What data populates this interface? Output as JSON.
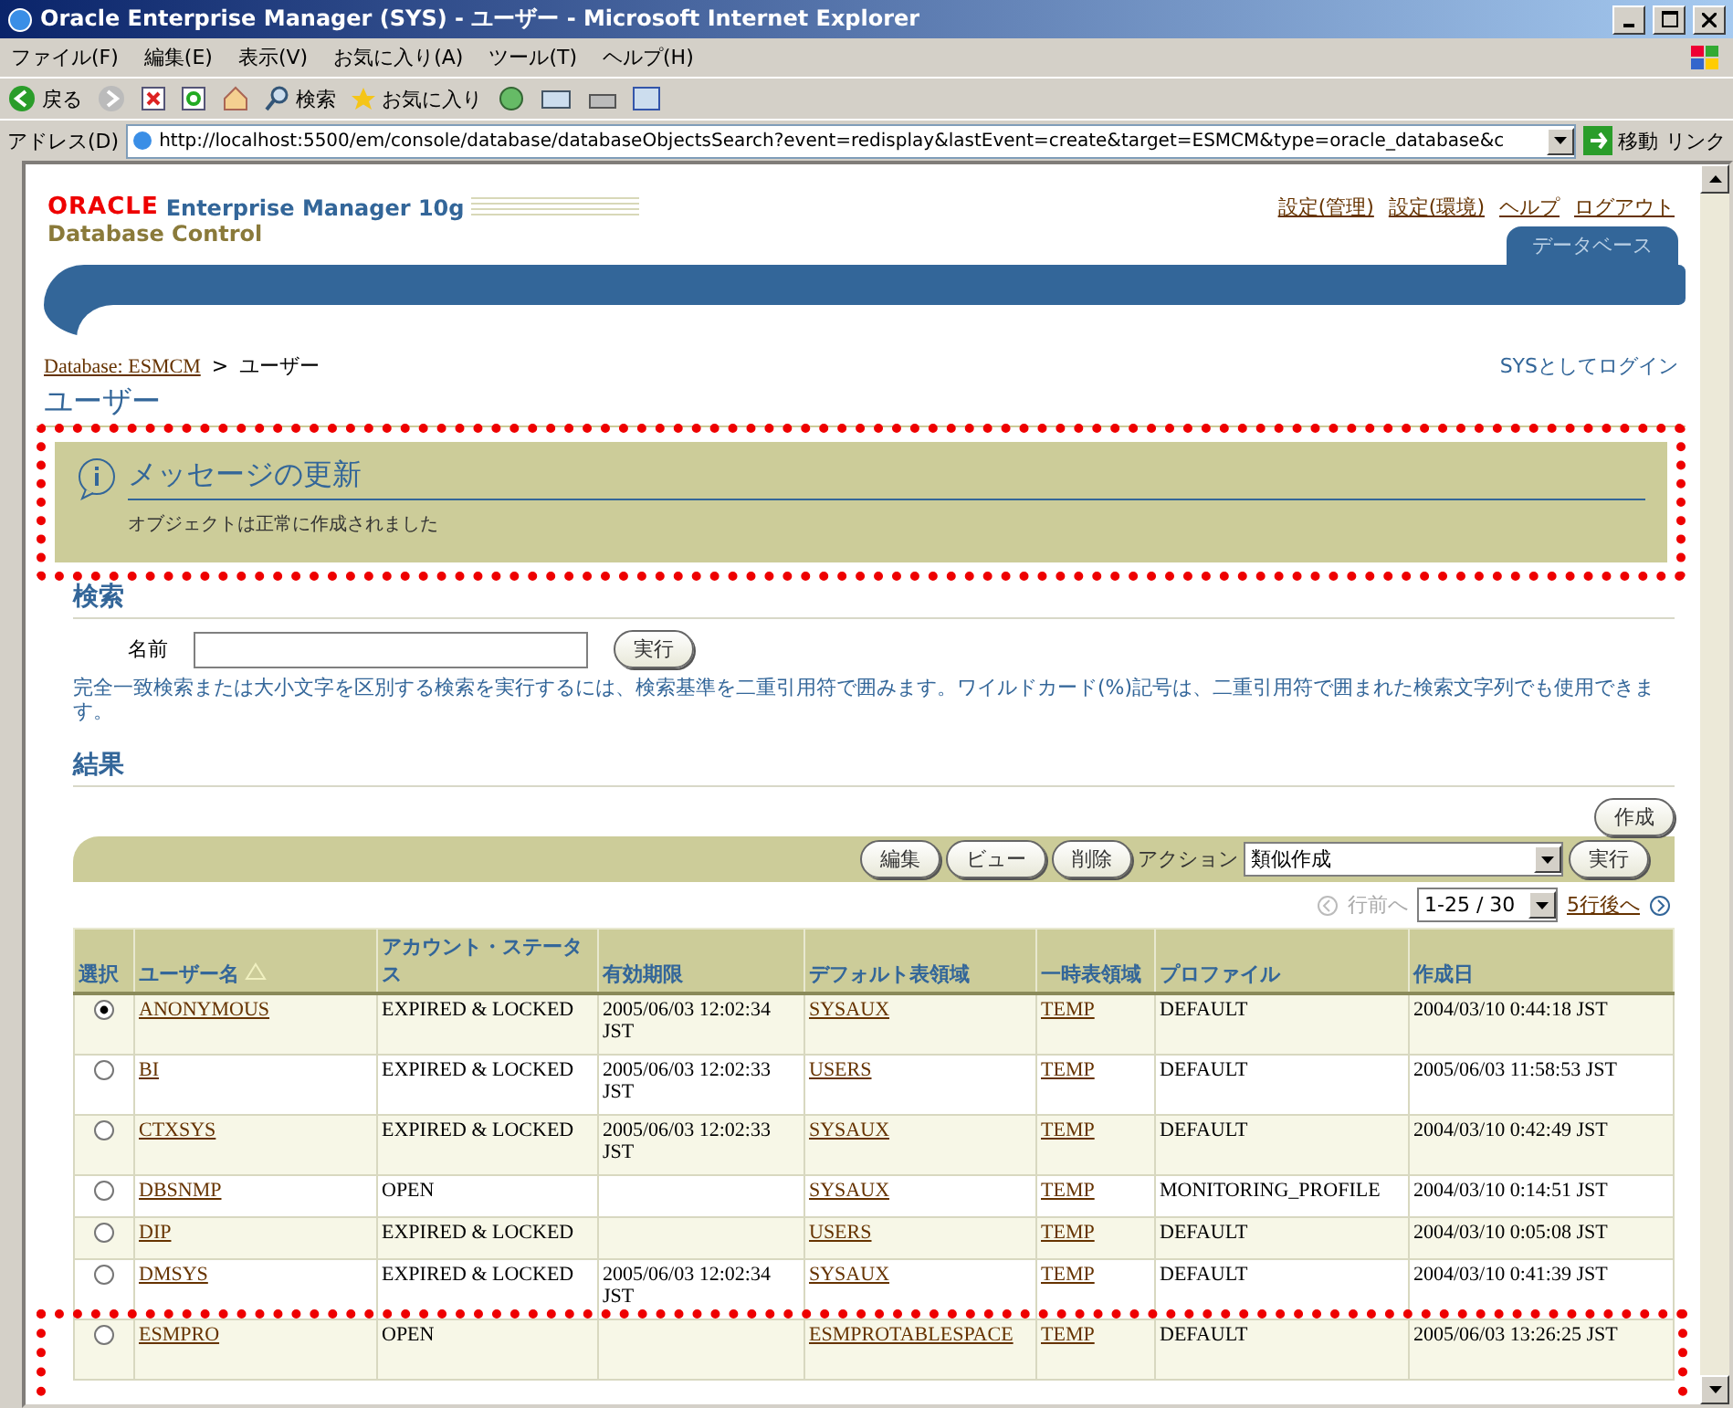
{
  "window": {
    "title": "Oracle Enterprise Manager (SYS) - ユーザー - Microsoft Internet Explorer"
  },
  "menu": [
    "ファイル(F)",
    "編集(E)",
    "表示(V)",
    "お気に入り(A)",
    "ツール(T)",
    "ヘルプ(H)"
  ],
  "toolbar": {
    "back": "戻る",
    "search": "検索",
    "favorites": "お気に入り"
  },
  "address": {
    "label": "アドレス(D)",
    "url": "http://localhost:5500/em/console/database/databaseObjectsSearch?event=redisplay&lastEvent=create&target=ESMCM&type=oracle_database&c",
    "go": "移動",
    "links": "リンク"
  },
  "header": {
    "logo": "ORACLE",
    "product": "Enterprise Manager 10g",
    "subtitle": "Database Control",
    "links": [
      "設定(管理)",
      "設定(環境)",
      "ヘルプ",
      "ログアウト"
    ],
    "tab": "データベース"
  },
  "breadcrumb": {
    "link": "Database: ESMCM",
    "separator": ">",
    "current": "ユーザー"
  },
  "login": "SYSとしてログイン",
  "page_title": "ユーザー",
  "message": {
    "title": "メッセージの更新",
    "text": "オブジェクトは正常に作成されました",
    "highlighted": true
  },
  "search": {
    "heading": "検索",
    "label": "名前",
    "button": "実行",
    "hint": "完全一致検索または大小文字を区別する検索を実行するには、検索基準を二重引用符で囲みます。ワイルドカード(%)記号は、二重引用符で囲まれた検索文字列でも使用できます。"
  },
  "results": {
    "heading": "結果",
    "create": "作成",
    "actions": [
      "編集",
      "ビュー",
      "削除"
    ],
    "action_label": "アクション",
    "action_select": "類似作成",
    "go": "実行",
    "pager": {
      "prev": "行前へ",
      "prev_disabled": true,
      "range": "1-25 / 30",
      "next": "5行後へ",
      "next_disabled": false
    }
  },
  "table": {
    "columns": [
      {
        "label": "選択",
        "sorted": false
      },
      {
        "label": "ユーザー名",
        "sorted": true
      },
      {
        "label": "アカウント・ステータス",
        "sorted": false
      },
      {
        "label": "有効期限",
        "sorted": false
      },
      {
        "label": "デフォルト表領域",
        "sorted": false
      },
      {
        "label": "一時表領域",
        "sorted": false
      },
      {
        "label": "プロファイル",
        "sorted": false
      },
      {
        "label": "作成日",
        "sorted": false
      }
    ],
    "rows": [
      {
        "selected": true,
        "highlighted": false,
        "name": "ANONYMOUS",
        "status": "EXPIRED & LOCKED",
        "expires": "2005/06/03 12:02:34 JST",
        "default_ts": "SYSAUX",
        "temp_ts": "TEMP",
        "profile": "DEFAULT",
        "created": "2004/03/10 0:44:18 JST"
      },
      {
        "selected": false,
        "highlighted": false,
        "name": "BI",
        "status": "EXPIRED & LOCKED",
        "expires": "2005/06/03 12:02:33 JST",
        "default_ts": "USERS",
        "temp_ts": "TEMP",
        "profile": "DEFAULT",
        "created": "2005/06/03 11:58:53 JST"
      },
      {
        "selected": false,
        "highlighted": false,
        "name": "CTXSYS",
        "status": "EXPIRED & LOCKED",
        "expires": "2005/06/03 12:02:33 JST",
        "default_ts": "SYSAUX",
        "temp_ts": "TEMP",
        "profile": "DEFAULT",
        "created": "2004/03/10 0:42:49 JST"
      },
      {
        "selected": false,
        "highlighted": false,
        "name": "DBSNMP",
        "status": "OPEN",
        "default_ts": "SYSAUX",
        "temp_ts": "TEMP",
        "profile": "MONITORING_PROFILE",
        "created": "2004/03/10 0:14:51 JST"
      },
      {
        "selected": false,
        "highlighted": false,
        "name": "DIP",
        "status": "EXPIRED & LOCKED",
        "default_ts": "USERS",
        "temp_ts": "TEMP",
        "profile": "DEFAULT",
        "created": "2004/03/10 0:05:08 JST"
      },
      {
        "selected": false,
        "highlighted": false,
        "name": "DMSYS",
        "status": "EXPIRED & LOCKED",
        "expires": "2005/06/03 12:02:34 JST",
        "default_ts": "SYSAUX",
        "temp_ts": "TEMP",
        "profile": "DEFAULT",
        "created": "2004/03/10 0:41:39 JST"
      },
      {
        "selected": false,
        "highlighted": true,
        "name": "ESMPRO",
        "status": "OPEN",
        "default_ts": "ESMPROTABLESPACE",
        "temp_ts": "TEMP",
        "profile": "DEFAULT",
        "created": "2005/06/03 13:26:25 JST"
      }
    ]
  }
}
